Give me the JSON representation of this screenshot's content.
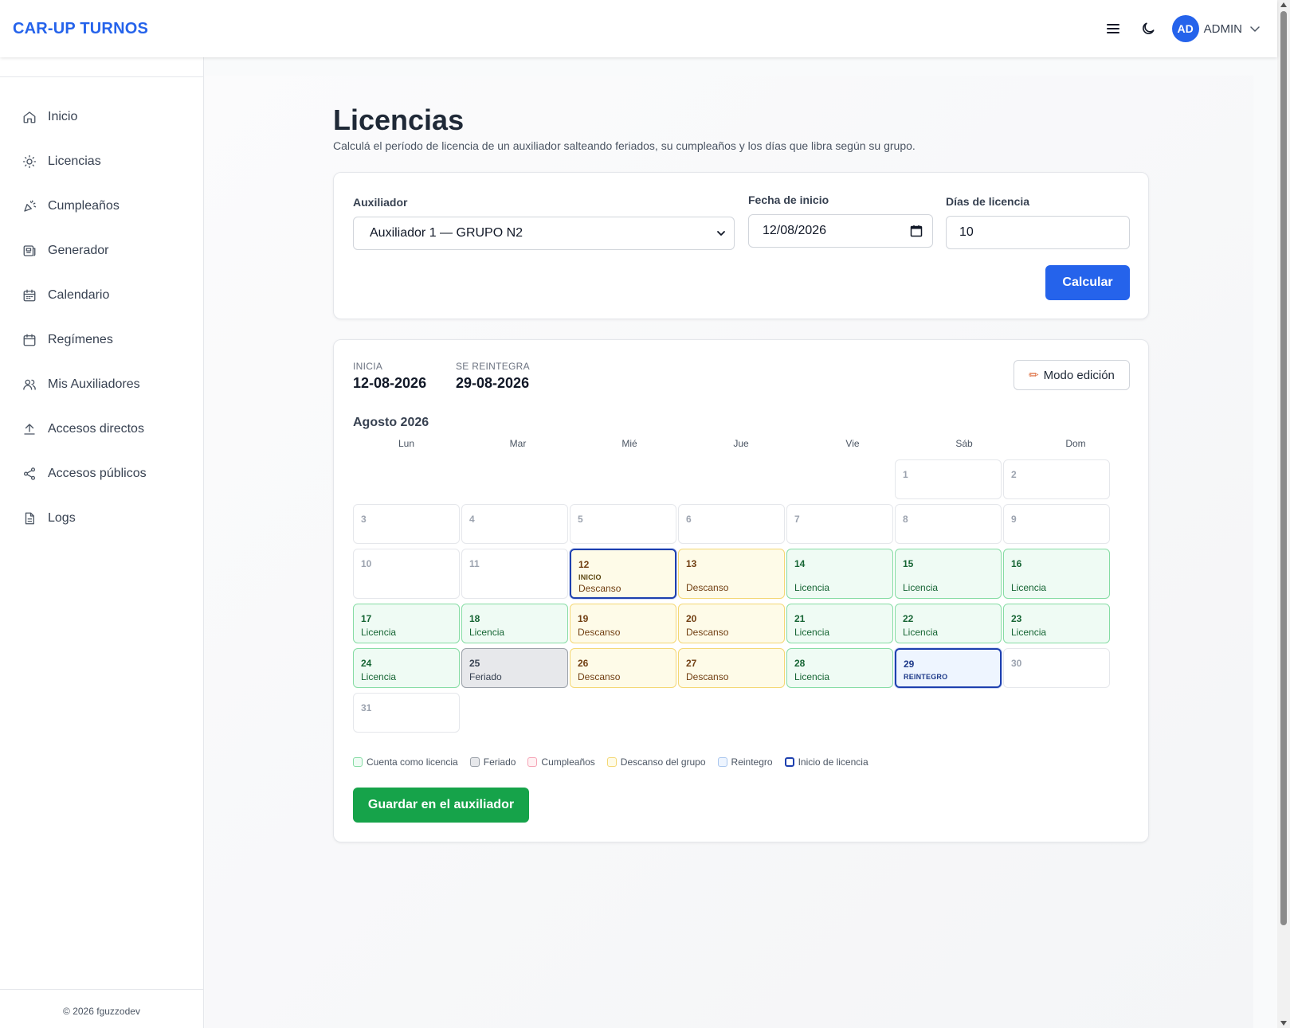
{
  "header": {
    "brand": "CAR-UP TURNOS",
    "avatar_initials": "AD",
    "user_name": "ADMIN"
  },
  "sidebar": {
    "items": [
      {
        "label": "Inicio",
        "icon": "home-icon"
      },
      {
        "label": "Licencias",
        "icon": "sun-icon"
      },
      {
        "label": "Cumpleaños",
        "icon": "party-icon"
      },
      {
        "label": "Generador",
        "icon": "generator-icon"
      },
      {
        "label": "Calendario",
        "icon": "calendar-icon"
      },
      {
        "label": "Regímenes",
        "icon": "calendar-icon"
      },
      {
        "label": "Mis Auxiliadores",
        "icon": "users-icon"
      },
      {
        "label": "Accesos directos",
        "icon": "upload-icon"
      },
      {
        "label": "Accesos públicos",
        "icon": "share-icon"
      },
      {
        "label": "Logs",
        "icon": "file-icon"
      }
    ],
    "footer": "© 2026 fguzzodev"
  },
  "page": {
    "title": "Licencias",
    "subtitle": "Calculá el período de licencia de un auxiliador salteando feriados, su cumpleaños y los días que libra según su grupo."
  },
  "form": {
    "auxiliador_label": "Auxiliador",
    "auxiliador_value": "Auxiliador 1 — GRUPO N2",
    "fecha_label": "Fecha de inicio",
    "fecha_value": "12/08/2026",
    "dias_label": "Días de licencia",
    "dias_value": "10",
    "calcular_label": "Calcular"
  },
  "result": {
    "inicia_label": "INICIA",
    "inicia_value": "12-08-2026",
    "reintegra_label": "SE REINTEGRA",
    "reintegra_value": "29-08-2026",
    "edit_label": "Modo edición",
    "month_label": "Agosto 2026",
    "weekdays": [
      "Lun",
      "Mar",
      "Mié",
      "Jue",
      "Vie",
      "Sáb",
      "Dom"
    ],
    "days": [
      {
        "n": "1",
        "type": "empty"
      },
      {
        "n": "2",
        "type": "empty"
      },
      {
        "n": "3",
        "type": "empty"
      },
      {
        "n": "4",
        "type": "empty"
      },
      {
        "n": "5",
        "type": "empty"
      },
      {
        "n": "6",
        "type": "empty"
      },
      {
        "n": "7",
        "type": "empty"
      },
      {
        "n": "8",
        "type": "empty"
      },
      {
        "n": "9",
        "type": "empty"
      },
      {
        "n": "10",
        "type": "empty"
      },
      {
        "n": "11",
        "type": "empty"
      },
      {
        "n": "12",
        "type": "des",
        "tag": "INICIO",
        "kind": "Descanso",
        "start": true
      },
      {
        "n": "13",
        "type": "des",
        "kind": "Descanso"
      },
      {
        "n": "14",
        "type": "lic",
        "kind": "Licencia"
      },
      {
        "n": "15",
        "type": "lic",
        "kind": "Licencia"
      },
      {
        "n": "16",
        "type": "lic",
        "kind": "Licencia"
      },
      {
        "n": "17",
        "type": "lic",
        "kind": "Licencia"
      },
      {
        "n": "18",
        "type": "lic",
        "kind": "Licencia"
      },
      {
        "n": "19",
        "type": "des",
        "kind": "Descanso"
      },
      {
        "n": "20",
        "type": "des",
        "kind": "Descanso"
      },
      {
        "n": "21",
        "type": "lic",
        "kind": "Licencia"
      },
      {
        "n": "22",
        "type": "lic",
        "kind": "Licencia"
      },
      {
        "n": "23",
        "type": "lic",
        "kind": "Licencia"
      },
      {
        "n": "24",
        "type": "lic",
        "kind": "Licencia"
      },
      {
        "n": "25",
        "type": "fer",
        "kind": "Feriado"
      },
      {
        "n": "26",
        "type": "des",
        "kind": "Descanso"
      },
      {
        "n": "27",
        "type": "des",
        "kind": "Descanso"
      },
      {
        "n": "28",
        "type": "lic",
        "kind": "Licencia"
      },
      {
        "n": "29",
        "type": "rein",
        "tag": "REINTEGRO"
      },
      {
        "n": "30",
        "type": "empty"
      },
      {
        "n": "31",
        "type": "empty"
      }
    ],
    "legend": [
      {
        "label": "Cuenta como licencia",
        "bg": "#effbf4",
        "border": "#86dca4"
      },
      {
        "label": "Feriado",
        "bg": "#e7e8eb",
        "border": "#9aa0a8"
      },
      {
        "label": "Cumpleaños",
        "bg": "#fff1f3",
        "border": "#f5a3b5"
      },
      {
        "label": "Descanso del grupo",
        "bg": "#fefbe8",
        "border": "#f4d774"
      },
      {
        "label": "Reintegro",
        "bg": "#eef5ff",
        "border": "#a9c6ee"
      },
      {
        "label": "Inicio de licencia",
        "bg": "#ffffff",
        "border": "#1e40af"
      }
    ],
    "save_label": "Guardar en el auxiliador"
  },
  "colors": {
    "accent": "#2563eb",
    "save": "#16a34a"
  }
}
